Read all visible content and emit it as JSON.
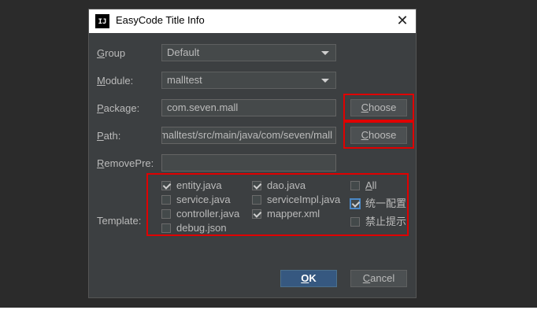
{
  "window": {
    "title": "EasyCode Title Info",
    "icon_text": "IJ"
  },
  "fields": {
    "group": {
      "label_u": "G",
      "label_rest": "roup",
      "value": "Default"
    },
    "module": {
      "label_u": "M",
      "label_rest": "odule:",
      "value": "malltest"
    },
    "package": {
      "label_u": "P",
      "label_rest": "ackage:",
      "value": "com.seven.mall"
    },
    "path": {
      "label_u": "P",
      "label_rest": "ath:",
      "value": "malltest/src/main/java/com/seven/mall"
    },
    "removepre": {
      "label_u": "R",
      "label_rest": "emovePre:",
      "value": ""
    }
  },
  "buttons": {
    "choose_u": "C",
    "choose_rest": "hoose",
    "ok_u": "O",
    "ok_rest": "K",
    "cancel_u": "C",
    "cancel_rest": "ancel"
  },
  "template": {
    "label": "Template:",
    "items": [
      {
        "name": "entity.java",
        "checked": true
      },
      {
        "name": "service.java",
        "checked": false
      },
      {
        "name": "controller.java",
        "checked": false
      },
      {
        "name": "debug.json",
        "checked": false
      },
      {
        "name": "dao.java",
        "checked": true
      },
      {
        "name": "serviceImpl.java",
        "checked": false
      },
      {
        "name": "mapper.xml",
        "checked": true
      }
    ],
    "all": {
      "u": "A",
      "rest": "ll",
      "checked": false
    },
    "unified_config": {
      "label": "统一配置",
      "checked": true
    },
    "disable_hint": {
      "label": "禁止提示",
      "checked": false
    }
  },
  "colors": {
    "accent": "#365880",
    "highlight": "#e00000"
  }
}
